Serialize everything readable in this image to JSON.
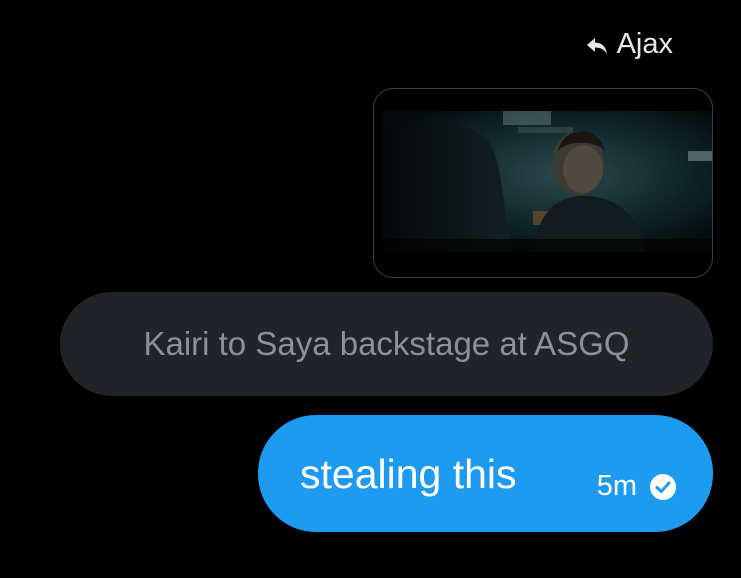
{
  "reply_header": {
    "name": "Ajax",
    "icon": "reply-arrow-icon"
  },
  "media": {
    "icon": "video-still"
  },
  "quoted_message": {
    "text": "Kairi to Saya backstage at ASGQ"
  },
  "sent_message": {
    "text": "stealing this",
    "timestamp": "5m",
    "status_icon": "read-check-icon"
  },
  "colors": {
    "background": "#000000",
    "sent_bubble": "#1d9bf0",
    "quoted_bubble": "#202327",
    "quoted_text": "#8b9196",
    "primary_text": "#e7e9ea"
  }
}
